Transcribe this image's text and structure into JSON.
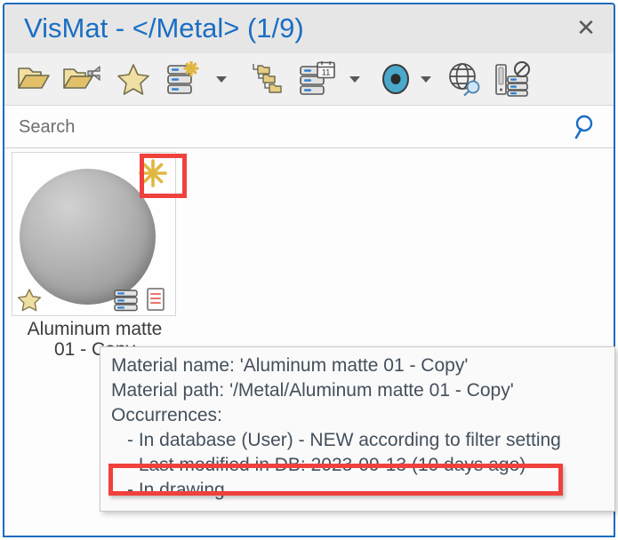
{
  "window": {
    "title": "VisMat - </Metal> (1/9)",
    "close_label": "✕",
    "title_color": "#1a6ec4",
    "border_color": "#1d6bbd",
    "titlebar_bg": "#e6e6e6"
  },
  "toolbar": {
    "items": [
      {
        "name": "open-folder-icon",
        "tooltip": "Open folder"
      },
      {
        "name": "import-folder-icon",
        "tooltip": "Import folder"
      },
      {
        "name": "favorites-star-icon",
        "tooltip": "Favorites"
      },
      {
        "name": "database-new-icon",
        "tooltip": "New in database"
      },
      {
        "name": "database-new-dropdown-caret",
        "tooltip": "New options"
      },
      {
        "name": "folder-tree-icon",
        "tooltip": "Folder structure"
      },
      {
        "name": "database-calendar-icon",
        "tooltip": "Database by date"
      },
      {
        "name": "database-calendar-dropdown-caret",
        "tooltip": "Date options"
      },
      {
        "name": "target-circle-icon",
        "tooltip": "Current selection"
      },
      {
        "name": "target-circle-dropdown-caret",
        "tooltip": "Selection options"
      },
      {
        "name": "globe-search-icon",
        "tooltip": "Search online"
      },
      {
        "name": "database-blocked-icon",
        "tooltip": "Database disabled"
      }
    ]
  },
  "search": {
    "placeholder": "Search",
    "value": "",
    "icon": "magnifier-icon"
  },
  "materials": [
    {
      "label_line1": "Aluminum matte",
      "label_line2": "01 - Copy",
      "preview": "sphere-gray-matte",
      "badges": [
        "new-asterisk-icon",
        "favorite-star-icon",
        "database-icon",
        "document-icon"
      ],
      "selected": true
    }
  ],
  "tooltip": {
    "lines": [
      {
        "text": "Material name: 'Aluminum matte 01 - Copy'",
        "indent": false
      },
      {
        "text": "Material path: '/Metal/Aluminum matte 01 - Copy'",
        "indent": false
      },
      {
        "text": "Occurrences:",
        "indent": false
      },
      {
        "text": "- In database (User) - NEW according to filter setting",
        "indent": true
      },
      {
        "text": "- Last modified in DB: 2023-09-13 (10 days ago)",
        "indent": true
      },
      {
        "text": "- In drawing",
        "indent": true
      }
    ]
  },
  "annotations": {
    "highlight_color": "#f0413c",
    "boxes": [
      {
        "name": "new-badge-highlight",
        "target": "new-asterisk-icon"
      },
      {
        "name": "last-modified-highlight",
        "target": "tooltip-line-last-modified"
      }
    ]
  }
}
